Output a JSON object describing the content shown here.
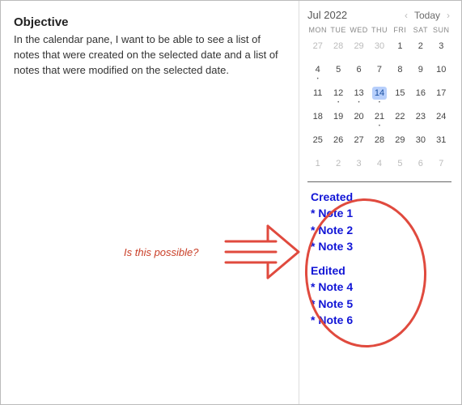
{
  "objective": {
    "title": "Objective",
    "body": "In the calendar pane, I want to be able to see a list of notes that were created on the selected date and a list of notes that were modified on the selected date."
  },
  "annotation": {
    "caption": "Is this possible?",
    "oval_color": "#e04a3e",
    "arrow_color": "#e04a3e"
  },
  "calendar": {
    "month_label": "Jul 2022",
    "today_label": "Today",
    "prev_glyph": "‹",
    "next_glyph": "›",
    "day_of_week": [
      "MON",
      "TUE",
      "WED",
      "THU",
      "FRI",
      "SAT",
      "SUN"
    ],
    "weeks": [
      [
        {
          "n": "27",
          "other": true
        },
        {
          "n": "28",
          "other": true
        },
        {
          "n": "29",
          "other": true
        },
        {
          "n": "30",
          "other": true
        },
        {
          "n": "1"
        },
        {
          "n": "2"
        },
        {
          "n": "3"
        }
      ],
      [
        {
          "n": "4",
          "dot": true
        },
        {
          "n": "5"
        },
        {
          "n": "6"
        },
        {
          "n": "7"
        },
        {
          "n": "8"
        },
        {
          "n": "9"
        },
        {
          "n": "10"
        }
      ],
      [
        {
          "n": "11"
        },
        {
          "n": "12",
          "dot": true
        },
        {
          "n": "13",
          "dot": true
        },
        {
          "n": "14",
          "dot": true,
          "selected": true
        },
        {
          "n": "15"
        },
        {
          "n": "16"
        },
        {
          "n": "17"
        }
      ],
      [
        {
          "n": "18"
        },
        {
          "n": "19"
        },
        {
          "n": "20"
        },
        {
          "n": "21",
          "dot": true
        },
        {
          "n": "22"
        },
        {
          "n": "23"
        },
        {
          "n": "24"
        }
      ],
      [
        {
          "n": "25"
        },
        {
          "n": "26"
        },
        {
          "n": "27"
        },
        {
          "n": "28"
        },
        {
          "n": "29"
        },
        {
          "n": "30"
        },
        {
          "n": "31"
        }
      ],
      [
        {
          "n": "1",
          "other": true
        },
        {
          "n": "2",
          "other": true
        },
        {
          "n": "3",
          "other": true
        },
        {
          "n": "4",
          "other": true
        },
        {
          "n": "5",
          "other": true
        },
        {
          "n": "6",
          "other": true
        },
        {
          "n": "7",
          "other": true
        }
      ]
    ]
  },
  "notes_panel": {
    "sections": [
      {
        "heading": "Created",
        "items": [
          "* Note 1",
          "* Note 2",
          "* Note 3"
        ]
      },
      {
        "heading": "Edited",
        "items": [
          "* Note 4",
          "* Note 5",
          "* Note 6"
        ]
      }
    ]
  }
}
